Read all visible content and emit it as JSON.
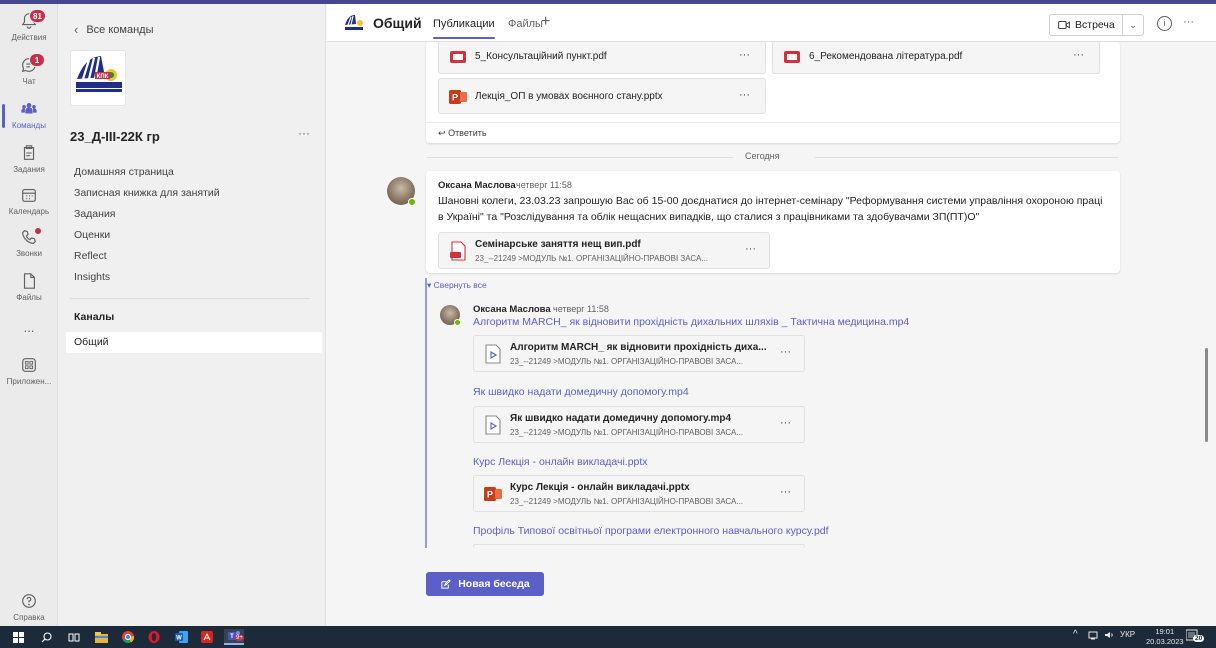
{
  "rail": {
    "items": [
      {
        "label": "Действия",
        "badge": "81"
      },
      {
        "label": "Чат",
        "badge": "1"
      },
      {
        "label": "Команды"
      },
      {
        "label": "Задания"
      },
      {
        "label": "Календарь"
      },
      {
        "label": "Звонки"
      },
      {
        "label": "Файлы"
      },
      {
        "label": "..."
      },
      {
        "label": "Приложен..."
      },
      {
        "label": "Справка"
      }
    ]
  },
  "sidebar": {
    "back_label": "Все команды",
    "team_name": "23_Д-ІІІ-22К гр",
    "team_more": "···",
    "logo_text": "КПК",
    "nav": [
      "Домашняя страница",
      "Записная книжка для занятий",
      "Задания",
      "Оценки",
      "Reflect",
      "Insights"
    ],
    "channels_heading": "Каналы",
    "channel": "Общий"
  },
  "header": {
    "title": "Общий",
    "tab_posts": "Публикации",
    "tab_files": "Файлы",
    "add": "+",
    "meet_label": "Встреча",
    "more": "···"
  },
  "feed": {
    "top_card": {
      "att1": "5_Консультаційний пункт.pdf",
      "att2": "6_Рекомендована література.pdf",
      "att3": "Лекція_ОП в умовах воєнного стану.pptx",
      "dots": "···",
      "reply": "Ответить"
    },
    "today": "Сегодня",
    "post": {
      "author": "Оксана Маслова",
      "time": "четверг 11:58",
      "text": "Шановні колеги, 23.03.23 запрошую Вас об 15-00 доєднатися до інтернет-семінару \"Реформування системи управління охороною праці в Україні\" та \"Розслідування та облік нещасних випадків, що сталися з працівниками та здобувачами ЗП(ПТ)О\"",
      "attachment": {
        "name": "Семінарське заняття нещ вип.pdf",
        "path": "23_--21249 >МОДУЛЬ №1. ОРГАНІЗАЦІЙНО-ПРАВОВІ ЗАСА..."
      }
    },
    "collapse": "Свернуть все",
    "reply": {
      "author": "Оксана Маслова",
      "time": "четверг 11:58",
      "links": [
        "Алгоритм MARCH_ як відновити прохідність дихальних шляхів _ Тактична медицина.mp4",
        "Як швидко надати домедичну допомогу.mp4",
        "Курс Лекція - онлайн викладачі.pptx",
        "Профіль Типової освітньої програми електронного навчального курсу.pdf"
      ],
      "attachments": [
        {
          "name": "Алгоритм MARCH_ як відновити прохідність диха...",
          "path": "23_--21249 >МОДУЛЬ №1. ОРГАНІЗАЦІЙНО-ПРАВОВІ ЗАСА..."
        },
        {
          "name": "Як швидко надати домедичну допомогу.mp4",
          "path": "23_--21249 >МОДУЛЬ №1. ОРГАНІЗАЦІЙНО-ПРАВОВІ ЗАСА..."
        },
        {
          "name": "Курс Лекція - онлайн викладачі.pptx",
          "path": "23_--21249 >МОДУЛЬ №1. ОРГАНІЗАЦІЙНО-ПРАВОВІ ЗАСА..."
        }
      ]
    },
    "new_conversation": "Новая беседа"
  },
  "taskbar": {
    "lang": "УКР",
    "time": "19:01",
    "date": "20.03.2023",
    "notif": "20",
    "teams_badge": "9+"
  },
  "colors": {
    "accent": "#5b5fc7",
    "badge": "#c4314b",
    "presence": "#6bb700",
    "ppt": "#c43e1c",
    "pdf": "#d13438"
  }
}
